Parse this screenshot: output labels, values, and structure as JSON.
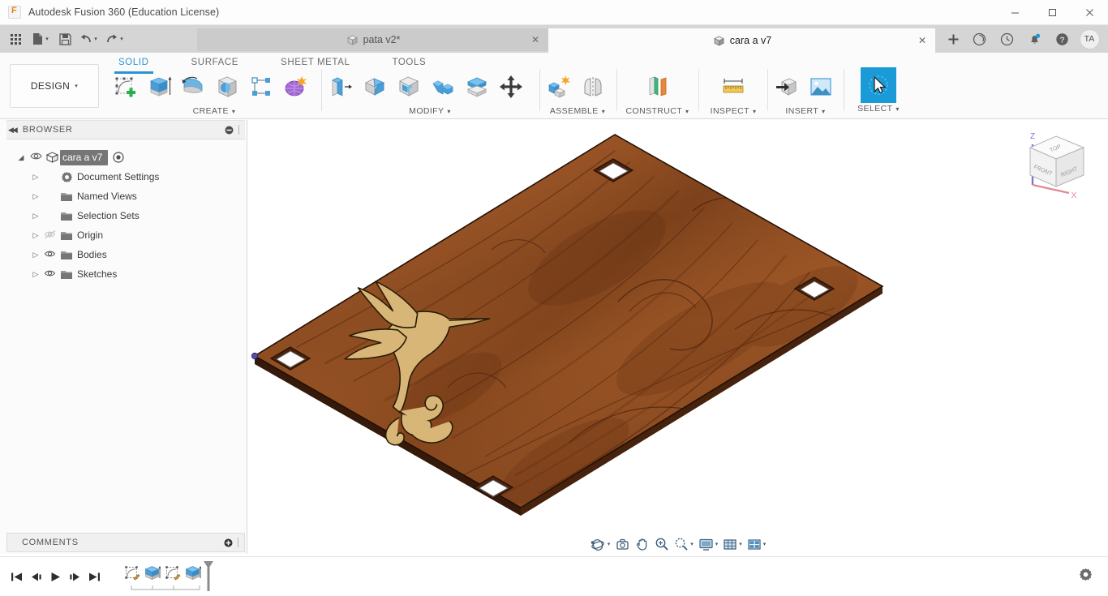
{
  "titlebar": {
    "app_title": "Autodesk Fusion 360 (Education License)",
    "logo_icon": "fusion-logo-icon",
    "minimize_label": "—",
    "maximize_label": "☐",
    "close_label": "✕"
  },
  "quick_access": {
    "grid_icon": "app-grid-icon",
    "new_icon": "new-file-icon",
    "save_icon": "save-icon",
    "undo_icon": "undo-icon",
    "redo_icon": "redo-icon",
    "caret": "▾"
  },
  "tabs": [
    {
      "label": "pata v2*",
      "active": false,
      "icon": "cube-icon",
      "close": "✕"
    },
    {
      "label": "cara a v7",
      "active": true,
      "icon": "cube-icon",
      "close": "✕"
    }
  ],
  "tab_actions": {
    "add_tab": "+",
    "job_status_icon": "job-status-icon",
    "recent_icon": "recent-clock-icon",
    "notifications_icon": "notification-bell-icon",
    "help_icon": "help-icon",
    "avatar_initials": "TA"
  },
  "ribbon": {
    "design_label": "DESIGN",
    "design_caret": "▾",
    "workspace_tabs": [
      {
        "label": "SOLID",
        "selected": true
      },
      {
        "label": "SURFACE",
        "selected": false
      },
      {
        "label": "SHEET METAL",
        "selected": false
      },
      {
        "label": "TOOLS",
        "selected": false
      }
    ],
    "groups": [
      {
        "label": "CREATE",
        "caret": "▾",
        "commands": [
          {
            "name": "create-sketch-icon"
          },
          {
            "name": "extrude-icon"
          },
          {
            "name": "revolve-icon"
          },
          {
            "name": "sphere-icon"
          },
          {
            "name": "pattern-icon"
          },
          {
            "name": "create-form-icon"
          }
        ]
      },
      {
        "label": "MODIFY",
        "caret": "▾",
        "commands": [
          {
            "name": "press-pull-icon"
          },
          {
            "name": "fillet-icon"
          },
          {
            "name": "shell-icon"
          },
          {
            "name": "combine-icon"
          },
          {
            "name": "split-face-icon"
          },
          {
            "name": "move-copy-icon"
          }
        ]
      },
      {
        "label": "ASSEMBLE",
        "caret": "▾",
        "commands": [
          {
            "name": "new-component-icon"
          },
          {
            "name": "joint-icon"
          }
        ]
      },
      {
        "label": "CONSTRUCT",
        "caret": "▾",
        "commands": [
          {
            "name": "offset-plane-icon"
          }
        ]
      },
      {
        "label": "INSPECT",
        "caret": "▾",
        "commands": [
          {
            "name": "measure-icon"
          }
        ]
      },
      {
        "label": "INSERT",
        "caret": "▾",
        "commands": [
          {
            "name": "insert-derive-icon"
          },
          {
            "name": "canvas-image-icon"
          }
        ]
      },
      {
        "label": "SELECT",
        "caret": "▾",
        "commands": [
          {
            "name": "select-cursor-icon",
            "active": true
          }
        ]
      }
    ]
  },
  "browser": {
    "panel_title": "BROWSER",
    "collapse_icon": "collapse-left-icon",
    "minimize_icon": "minimize-panel-icon",
    "root": {
      "label": "cara a v7",
      "icon": "component-cube-icon",
      "eye_icon": "eye-visible-icon",
      "activate_icon": "radio-active-icon",
      "expander": "◢"
    },
    "items": [
      {
        "label": "Document Settings",
        "icon": "gear-icon",
        "eye": "none",
        "expander": "▷"
      },
      {
        "label": "Named Views",
        "icon": "folder-icon",
        "eye": "none",
        "expander": "▷"
      },
      {
        "label": "Selection Sets",
        "icon": "folder-icon",
        "eye": "none",
        "expander": "▷"
      },
      {
        "label": "Origin",
        "icon": "folder-icon",
        "eye": "hidden",
        "expander": "▷"
      },
      {
        "label": "Bodies",
        "icon": "folder-icon",
        "eye": "visible",
        "expander": "▷"
      },
      {
        "label": "Sketches",
        "icon": "folder-icon",
        "eye": "visible",
        "expander": "▷"
      }
    ]
  },
  "comments": {
    "panel_title": "COMMENTS",
    "add_icon": "add-comment-icon",
    "minimize_icon": "minimize-panel-icon"
  },
  "canvas": {
    "model_name": "cara a v7 wooden plate",
    "description": "Isometric view of a rectangular wooden board with four square through-holes and a light tan hummingbird inlay on the lower-left face",
    "background_color": "#ffffff",
    "wood_color": "#8b4a22",
    "wood_dark": "#5f2c10",
    "inlay_color": "#d8b678",
    "edge_color": "#2c2c2c",
    "viewcube": {
      "faces": {
        "top": "TOP",
        "front": "FRONT",
        "right": "RIGHT"
      },
      "axes": {
        "z": "Z",
        "x": "X"
      },
      "z_axis_color": "#7d74d8",
      "x_axis_color": "#e08a93"
    }
  },
  "navbar": {
    "items": [
      {
        "name": "orbit-icon",
        "caret": "▾"
      },
      {
        "name": "look-at-icon",
        "caret": ""
      },
      {
        "name": "pan-hand-icon",
        "caret": ""
      },
      {
        "name": "zoom-icon",
        "caret": ""
      },
      {
        "name": "zoom-window-icon",
        "caret": "▾"
      },
      {
        "name": "display-settings-icon",
        "caret": "▾"
      },
      {
        "name": "grid-snap-icon",
        "caret": "▾"
      },
      {
        "name": "viewports-icon",
        "caret": "▾"
      }
    ]
  },
  "timeline": {
    "playback": [
      {
        "name": "go-to-beginning-icon",
        "glyph": "⏮"
      },
      {
        "name": "step-back-icon",
        "glyph": "⏴"
      },
      {
        "name": "play-icon",
        "glyph": "▶"
      },
      {
        "name": "step-forward-icon",
        "glyph": "⏵"
      },
      {
        "name": "go-to-end-icon",
        "glyph": "⏭"
      }
    ],
    "features": [
      {
        "name": "timeline-sketch-1-icon"
      },
      {
        "name": "timeline-extrude-1-icon"
      },
      {
        "name": "timeline-sketch-2-icon"
      },
      {
        "name": "timeline-extrude-2-icon"
      }
    ],
    "marker_name": "timeline-end-marker",
    "settings_icon": "settings-gear-icon"
  }
}
